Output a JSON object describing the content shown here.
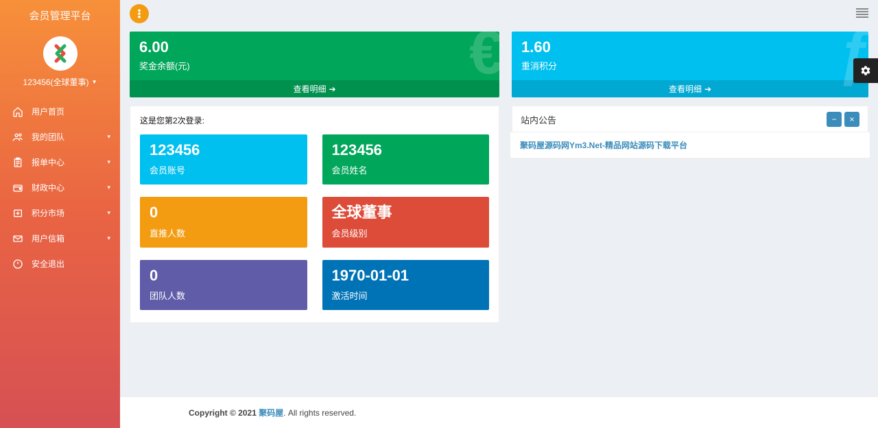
{
  "sidebar": {
    "title": "会员管理平台",
    "user_label": "123456(全球董事)",
    "items": [
      {
        "label": "用户首页",
        "icon": "home",
        "expandable": false
      },
      {
        "label": "我的团队",
        "icon": "users",
        "expandable": true
      },
      {
        "label": "报单中心",
        "icon": "clipboard",
        "expandable": true
      },
      {
        "label": "财政中心",
        "icon": "wallet",
        "expandable": true
      },
      {
        "label": "积分市场",
        "icon": "coins",
        "expandable": true
      },
      {
        "label": "用户信箱",
        "icon": "mail",
        "expandable": true
      },
      {
        "label": "安全退出",
        "icon": "power",
        "expandable": false
      }
    ]
  },
  "stats": {
    "bonus": {
      "value": "6.00",
      "label": "奖金余额(元)",
      "footer": "查看明细",
      "glyph": "€"
    },
    "points": {
      "value": "1.60",
      "label": "重消积分",
      "footer": "查看明细",
      "glyph": "ƒ"
    }
  },
  "login_panel": {
    "login_text": "这是您第2次登录:",
    "tiles": [
      {
        "value": "123456",
        "label": "会员账号",
        "color": "bg-blue"
      },
      {
        "value": "123456",
        "label": "会员姓名",
        "color": "bg-green"
      },
      {
        "value": "0",
        "label": "直推人数",
        "color": "bg-orange"
      },
      {
        "value": "全球董事",
        "label": "会员级别",
        "color": "bg-red"
      },
      {
        "value": "0",
        "label": "团队人数",
        "color": "bg-purple"
      },
      {
        "value": "1970-01-01",
        "label": "激活时间",
        "color": "bg-darkblue"
      }
    ]
  },
  "announcements": {
    "title": "站内公告",
    "items": [
      {
        "text": "聚码屋源码网Ym3.Net-精品网站源码下载平台"
      }
    ]
  },
  "footer": {
    "copyright_prefix": "Copyright © 2021 ",
    "link_text": "聚码屋",
    "suffix": ". All rights reserved."
  }
}
